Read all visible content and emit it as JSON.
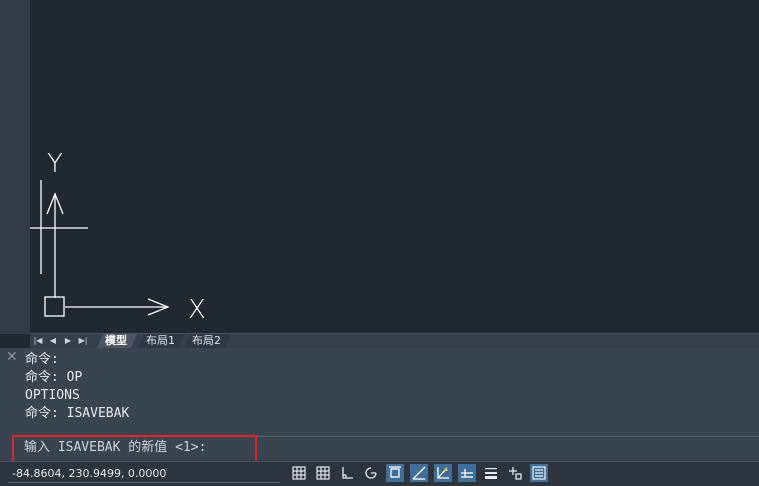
{
  "ucs": {
    "x_label": "X",
    "y_label": "Y"
  },
  "layout_tabs": {
    "nav": [
      "|◀",
      "◀",
      "▶",
      "▶|"
    ],
    "tabs": [
      {
        "label": "模型",
        "active": true
      },
      {
        "label": "布局1",
        "active": false
      },
      {
        "label": "布局2",
        "active": false
      }
    ]
  },
  "command": {
    "close_glyph": "✕",
    "history": [
      "命令:",
      "命令: OP",
      "OPTIONS",
      "命令: ISAVEBAK"
    ],
    "prompt": "输入 ISAVEBAK 的新值 <1>:",
    "highlight_color": "#e1262e"
  },
  "statusbar": {
    "coordinates": "-84.8604, 230.9499, 0.0000",
    "icons": [
      {
        "name": "model-space-grid-icon",
        "on": false
      },
      {
        "name": "grid-display-icon",
        "on": false
      },
      {
        "name": "ortho-mode-icon",
        "on": false
      },
      {
        "name": "polar-tracking-icon",
        "on": false
      },
      {
        "name": "object-snap-icon",
        "on": true
      },
      {
        "name": "object-snap-tracking-icon",
        "on": true
      },
      {
        "name": "dynamic-ucs-icon",
        "on": true
      },
      {
        "name": "dynamic-input-icon",
        "on": true
      },
      {
        "name": "lineweight-icon",
        "on": false
      },
      {
        "name": "selection-cycling-icon",
        "on": false
      },
      {
        "name": "quick-properties-icon",
        "on": true
      }
    ]
  },
  "colors": {
    "canvas": "#212830",
    "panel": "#3a4350",
    "statusbar": "#2d343e",
    "toggle_on": "#3f6f99"
  }
}
